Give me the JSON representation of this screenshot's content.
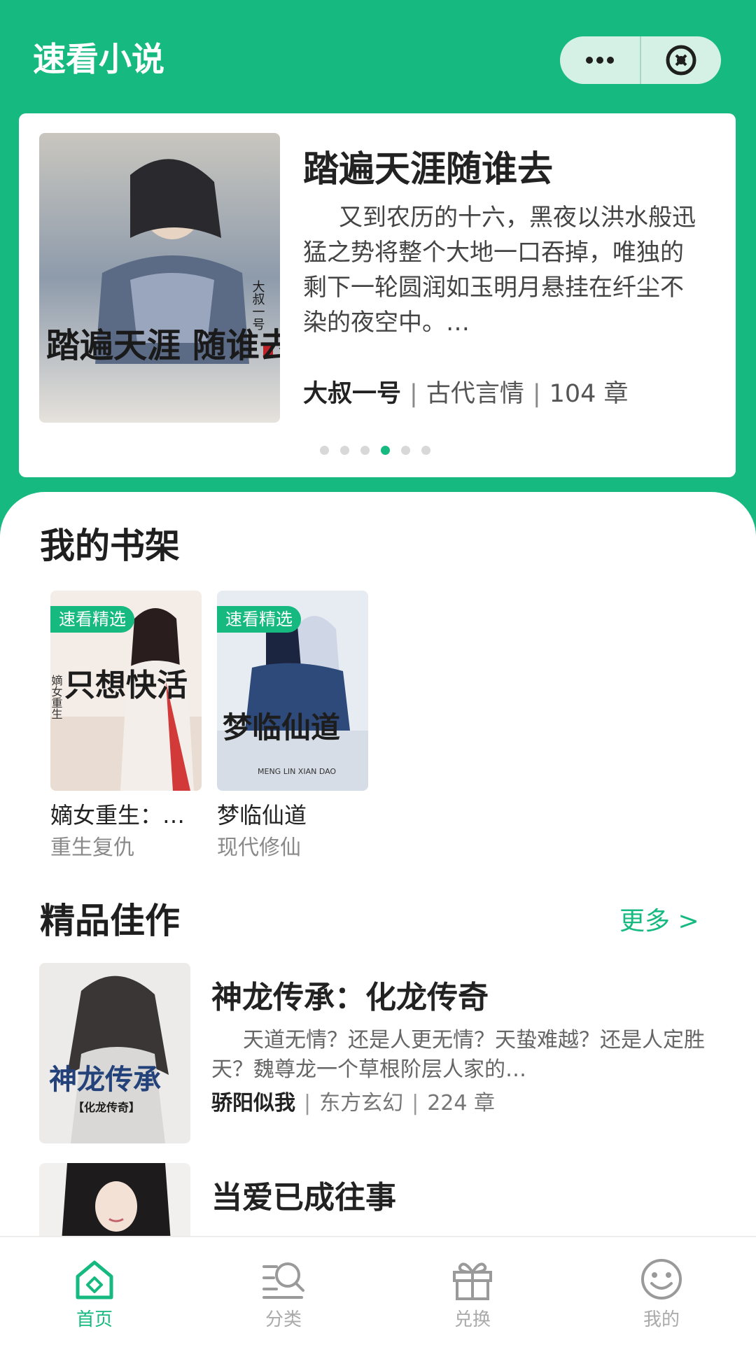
{
  "app": {
    "title": "速看小说"
  },
  "capsule": {
    "more_icon": "ellipsis-icon",
    "close_icon": "close-circle-icon"
  },
  "colors": {
    "brand": "#16b980",
    "header_bg": "#16b980"
  },
  "banner": {
    "title": "踏遍天涯随谁去",
    "description": "又到农历的十六，黑夜以洪水般迅猛之势将整个大地一口吞掉，唯独的剩下一轮圆润如玉明月悬挂在纤尘不染的夜空中。…",
    "author": "大叔一号",
    "category": "古代言情",
    "chapters": "104 章",
    "cover_text": "踏遍天涯 随谁去",
    "cover_small_text": "大叔一号",
    "dots_count": 6,
    "active_dot": 4
  },
  "shelf": {
    "title": "我的书架",
    "items": [
      {
        "tag": "速看精选",
        "title": "嫡女重生：…",
        "category": "重生复仇",
        "cover_text": "只想快活",
        "cover_small_text": "嫡女重生"
      },
      {
        "tag": "速看精选",
        "title": "梦临仙道",
        "category": "现代修仙",
        "cover_text": "梦临仙道",
        "cover_small_text": "MENG LIN XIAN DAO"
      }
    ]
  },
  "featured": {
    "title": "精品佳作",
    "more_label": "更多 >",
    "books": [
      {
        "title": "神龙传承：化龙传奇",
        "description": "天道无情？还是人更无情？天蛰难越？还是人定胜天？魏尊龙一个草根阶层人家的…",
        "author": "骄阳似我",
        "category": "东方玄幻",
        "chapters": "224 章",
        "cover_text": "神龙传承",
        "cover_small_text": "【化龙传奇】"
      },
      {
        "title": "当爱已成往事",
        "description": "",
        "author": "",
        "category": "",
        "chapters": ""
      }
    ]
  },
  "tabbar": {
    "tabs": [
      {
        "label": "首页",
        "icon": "home-icon",
        "active": true
      },
      {
        "label": "分类",
        "icon": "category-search-icon",
        "active": false
      },
      {
        "label": "兑换",
        "icon": "gift-icon",
        "active": false
      },
      {
        "label": "我的",
        "icon": "smiley-icon",
        "active": false
      }
    ]
  }
}
